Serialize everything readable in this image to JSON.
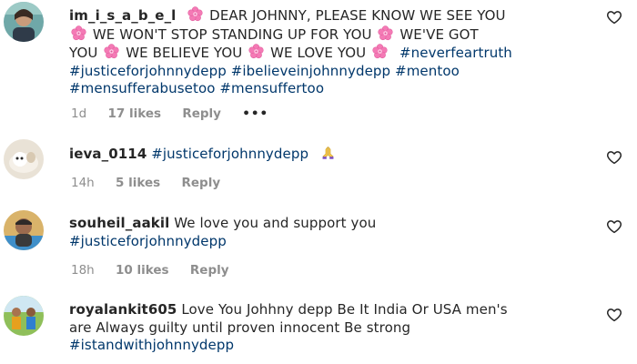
{
  "comments": [
    {
      "username": "im_i_s_a_b_e_l",
      "line1": "DEAR JOHNNY, PLEASE KNOW WE SEE YOU",
      "line2a": "WE WON'T STOP STANDING UP FOR YOU",
      "line2b": "WE'VE GOT",
      "line3a": "YOU",
      "line3b": "WE BELIEVE YOU",
      "line3c": "WE LOVE YOU",
      "line3tag": "#neverfeartruth",
      "line4": "#justiceforjohnnydepp #ibelieveinjohnnydepp #mentoo",
      "line5": "#mensufferabusetoo #mensuffertoo",
      "time": "1d",
      "likes": "17 likes",
      "reply": "Reply",
      "more": "•••"
    },
    {
      "username": "ieva_0114",
      "tag": "#justiceforjohnnydepp",
      "time": "14h",
      "likes": "5 likes",
      "reply": "Reply"
    },
    {
      "username": "souheil_aakil",
      "text": "We love you and support you",
      "tag": "#justiceforjohnnydepp",
      "time": "18h",
      "likes": "10 likes",
      "reply": "Reply"
    },
    {
      "username": "royalankit605",
      "text1": "Love You Johhny depp Be It India Or USA men's",
      "text2": "are Always guilty until proven innocent Be strong",
      "tag": "#istandwithjohnnydepp"
    }
  ],
  "icons": {
    "flower": "cherry-blossom-emoji",
    "hands": "folded-hands-emoji",
    "like": "heart-outline-icon"
  },
  "colors": {
    "text": "#262626",
    "hashtag": "#00376b",
    "meta": "#8e8e8e",
    "flower": "#f47ab5"
  }
}
